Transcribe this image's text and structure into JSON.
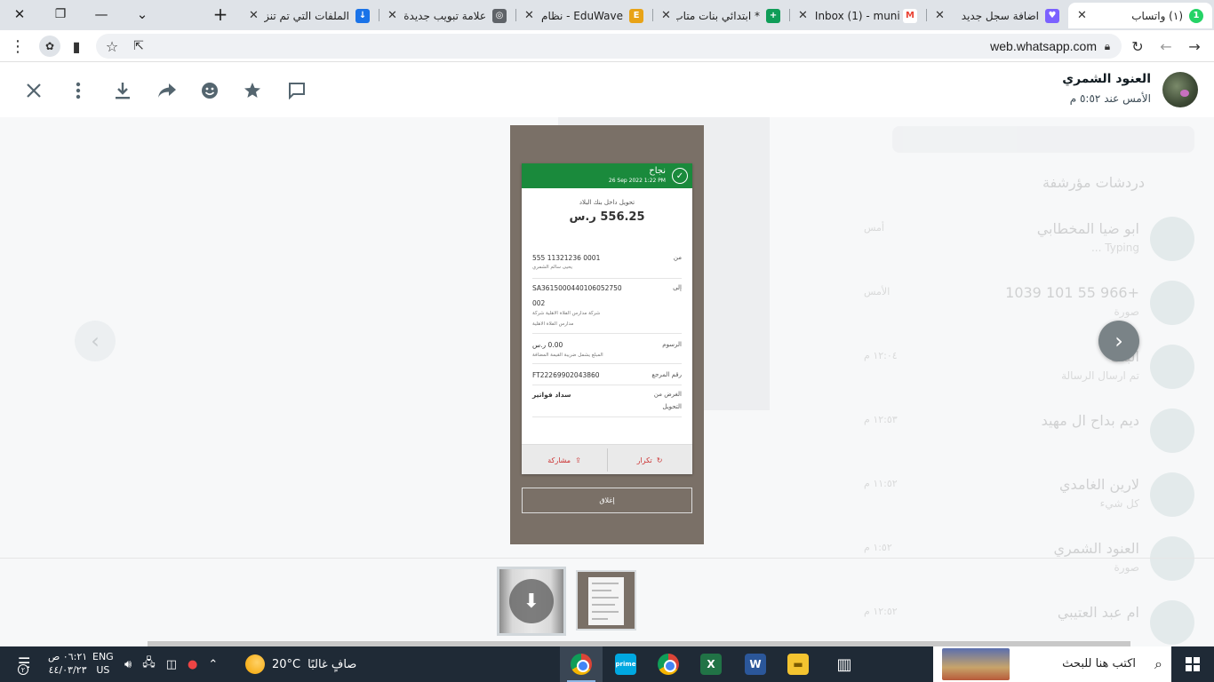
{
  "browser": {
    "window_controls": {
      "close": "✕",
      "restore": "❐",
      "minimize": "—",
      "tab_search": "⌄"
    },
    "new_tab": "+",
    "tabs": [
      {
        "label": "(١) واتساب",
        "favicon_color": "#25d366",
        "favicon_text": "1",
        "active": true
      },
      {
        "label": "اضافة سجل جديد",
        "favicon_color": "#7b61ff",
        "favicon_text": "♥",
        "active": false
      },
      {
        "label": "Inbox (1) - munir",
        "favicon_color": "#ea4335",
        "favicon_text": "M",
        "active": false
      },
      {
        "label": "* ابتدائي بنات متاب",
        "favicon_color": "#0f9d58",
        "favicon_text": "+",
        "active": false
      },
      {
        "label": "EduWave - نظام نور",
        "favicon_color": "#e8a317",
        "favicon_text": "E",
        "active": false
      },
      {
        "label": "علامة تبويب جديدة",
        "favicon_color": "#5f6368",
        "favicon_text": "◎",
        "active": false
      },
      {
        "label": "الملفات التي تم تنزيلها",
        "favicon_color": "#1a73e8",
        "favicon_text": "↓",
        "active": false
      }
    ],
    "url": "web.whatsapp.com"
  },
  "viewer": {
    "contact_name": "العنود الشمري",
    "timestamp": "الأمس عند ٥:٥٢ م",
    "actions": {
      "close": "close",
      "menu": "menu",
      "download": "download",
      "forward": "forward",
      "react": "react",
      "star": "star",
      "reply": "reply"
    }
  },
  "receipt": {
    "status": "نجاح",
    "date": "26 Sep 2022 1:22 PM",
    "transfer_type": "تحويل داخل بنك البلاد",
    "amount": "556.25 ر.س",
    "rows": [
      {
        "label": "من",
        "value": "555  11321236  0001",
        "sub": "يحيى سالم الشمري"
      },
      {
        "label": "إلى",
        "value": "SA3615000440106052750",
        "value2": "002",
        "sub": "شركة مدارس الفلاة الاهلية شركة",
        "sub2": "مدارس الفلاة الاهلية"
      },
      {
        "label": "الرسوم",
        "value": "0.00 ر.س",
        "sub": "المبلغ يشمل ضريبة القيمة المضافة"
      },
      {
        "label": "رقم المرجع",
        "value": "FT22269902043860"
      },
      {
        "label": "الغرض من",
        "label2": "التحويل",
        "value": "سداد فواتير"
      }
    ],
    "repeat": "تكرار",
    "share": "مشاركة",
    "close_btn": "إغلاق"
  },
  "background_chats": {
    "header": "دردشات مؤرشفة",
    "rows": [
      {
        "name": "ابو ضيا المخطابي",
        "msg": "Typing ...",
        "time": "أمس"
      },
      {
        "name": "+966 55 101 1039",
        "msg": "صورة",
        "time": "الأمس"
      },
      {
        "name": "البنك",
        "msg": "تم ارسال الرسالة",
        "time": "١٢:٠٤ م"
      },
      {
        "name": "ديم بداح ال مهيد",
        "msg": "",
        "time": "١٢:٥٣ م"
      },
      {
        "name": "لارين الغامدي",
        "msg": "كل شيء",
        "time": "١١:٥٢ م"
      },
      {
        "name": "العنود الشمري",
        "msg": "صورة",
        "time": "١:٥٢ م"
      },
      {
        "name": "ام عبد العتيبي",
        "msg": "",
        "time": "١٢:٥٢ م"
      }
    ]
  },
  "taskbar": {
    "search_placeholder": "اكتب هنا للبحث",
    "weather_temp": "20°C",
    "weather_desc": "صافٍ غالبًا",
    "lang_line1": "ENG",
    "lang_line2": "US",
    "time": "٠٦:٢١ ص",
    "date": "٤٤/٠٣/٢٣",
    "notification_count": "٢"
  }
}
